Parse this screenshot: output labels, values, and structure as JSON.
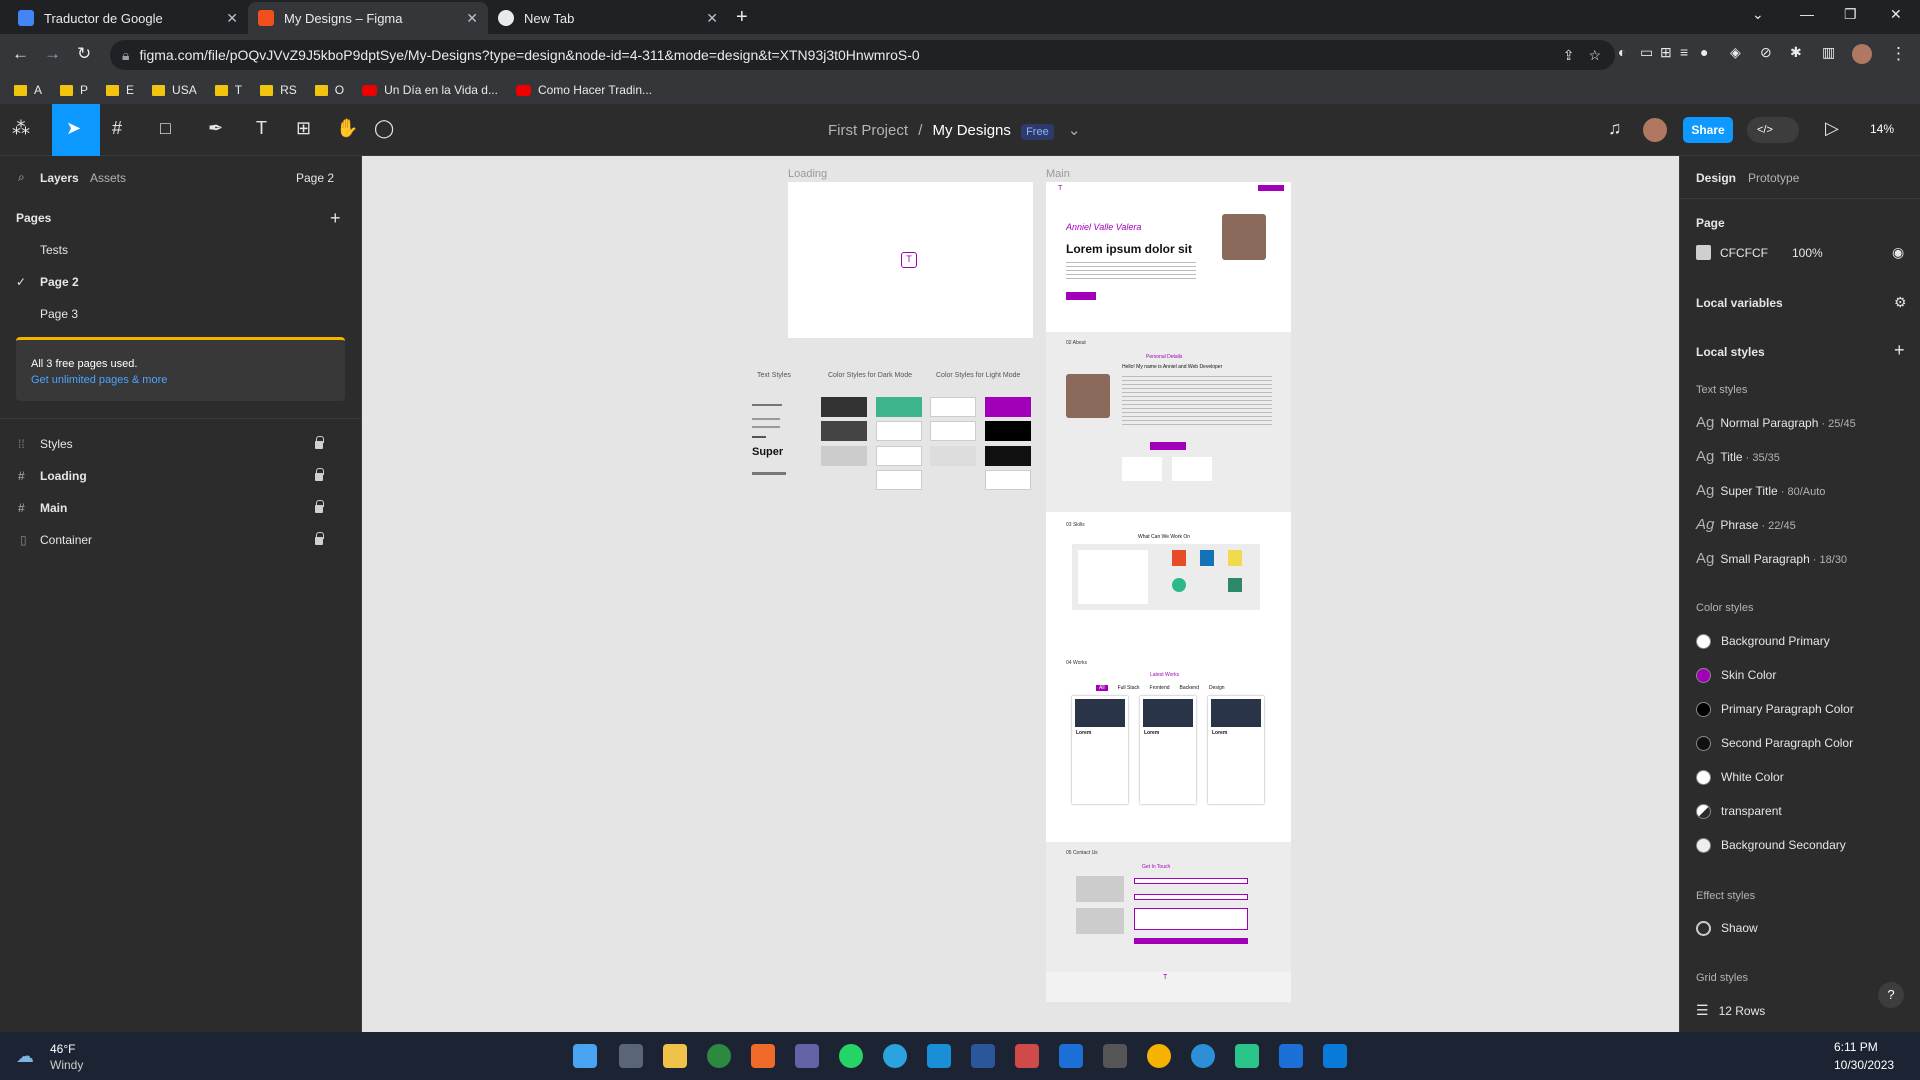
{
  "browser": {
    "tabs": [
      {
        "title": "Traductor de Google",
        "favicon": "google-translate-icon",
        "color": "#4285f4"
      },
      {
        "title": "My Designs – Figma",
        "favicon": "figma-icon",
        "color": "#f24e1e"
      },
      {
        "title": "New Tab",
        "favicon": "chrome-icon",
        "color": "#e8eaed"
      }
    ],
    "url": "figma.com/file/pOQvJVvZ9J5kboP9dptSye/My-Designs?type=design&node-id=4-311&mode=design&t=XTN93j3t0HnwmroS-0",
    "bookmarks": [
      "A",
      "P",
      "E",
      "USA",
      "T",
      "RS",
      "O",
      "Un Día en la Vida d...",
      "Como Hacer Tradin..."
    ]
  },
  "figma": {
    "project": "First Project",
    "file": "My Designs",
    "badge": "Free",
    "share": "Share",
    "zoom": "14%",
    "accent": "#0d99ff"
  },
  "left_panel": {
    "tab_layers": "Layers",
    "tab_assets": "Assets",
    "page_selector": "Page 2",
    "pages_title": "Pages",
    "pages": [
      "Tests",
      "Page 2",
      "Page 3"
    ],
    "current_page": "Page 2",
    "banner_text": "All 3 free pages used.",
    "banner_link": "Get unlimited pages & more",
    "layers": [
      "Styles",
      "Loading",
      "Main",
      "Container"
    ]
  },
  "canvas": {
    "background": "#e5e5e5",
    "frame_loading": "Loading",
    "frame_main": "Main",
    "text_styles_label": "Text Styles",
    "dark_label": "Color Styles for Dark Mode",
    "light_label": "Color Styles for Light Mode",
    "super_sample": "Super",
    "main_name": "Anniel Valle Valera",
    "main_heading": "Lorem ipsum dolor sit",
    "about_label": "02 About",
    "personal_details": "Personal Details",
    "hello": "Hello! My name is Anniel and Web Developer",
    "skills_label": "03 Skills",
    "skills_heading": "What Can We Work On",
    "works_label": "04 Works",
    "works_heading": "Latest Works",
    "works_tabs": [
      "All",
      "Full Stack",
      "Frontend",
      "Backend",
      "Design"
    ],
    "work_card_title": "Lorem",
    "contact_label": "05 Contact Us",
    "contact_heading": "Get In Touch",
    "skin_color": "#a100b8"
  },
  "right_panel": {
    "tab_design": "Design",
    "tab_prototype": "Prototype",
    "page_title": "Page",
    "page_color": "CFCFCF",
    "page_opacity": "100%",
    "local_variables": "Local variables",
    "local_styles": "Local styles",
    "text_styles_title": "Text styles",
    "text_styles": [
      {
        "name": "Normal Paragraph",
        "spec": " · 25/45"
      },
      {
        "name": "Title",
        "spec": " · 35/35"
      },
      {
        "name": "Super Title",
        "spec": " · 80/Auto"
      },
      {
        "name": "Phrase",
        "spec": " · 22/45"
      },
      {
        "name": "Small Paragraph",
        "spec": " · 18/30"
      }
    ],
    "color_styles_title": "Color styles",
    "color_styles": [
      {
        "name": "Background Primary",
        "color": "#ffffff"
      },
      {
        "name": "Skin Color",
        "color": "#a100b8"
      },
      {
        "name": "Primary Paragraph Color",
        "color": "#000000"
      },
      {
        "name": "Second Paragraph Color",
        "color": "#111111"
      },
      {
        "name": "White Color",
        "color": "#ffffff"
      },
      {
        "name": "transparent",
        "color": "transparent"
      },
      {
        "name": "Background Secondary",
        "color": "#eeeeee"
      }
    ],
    "effect_styles_title": "Effect styles",
    "effect_style": "Shaow",
    "grid_styles_title": "Grid styles",
    "grid_style": "12 Rows"
  },
  "taskbar": {
    "weather_temp": "46°F",
    "weather_desc": "Windy",
    "time": "6:11 PM",
    "date": "10/30/2023"
  }
}
